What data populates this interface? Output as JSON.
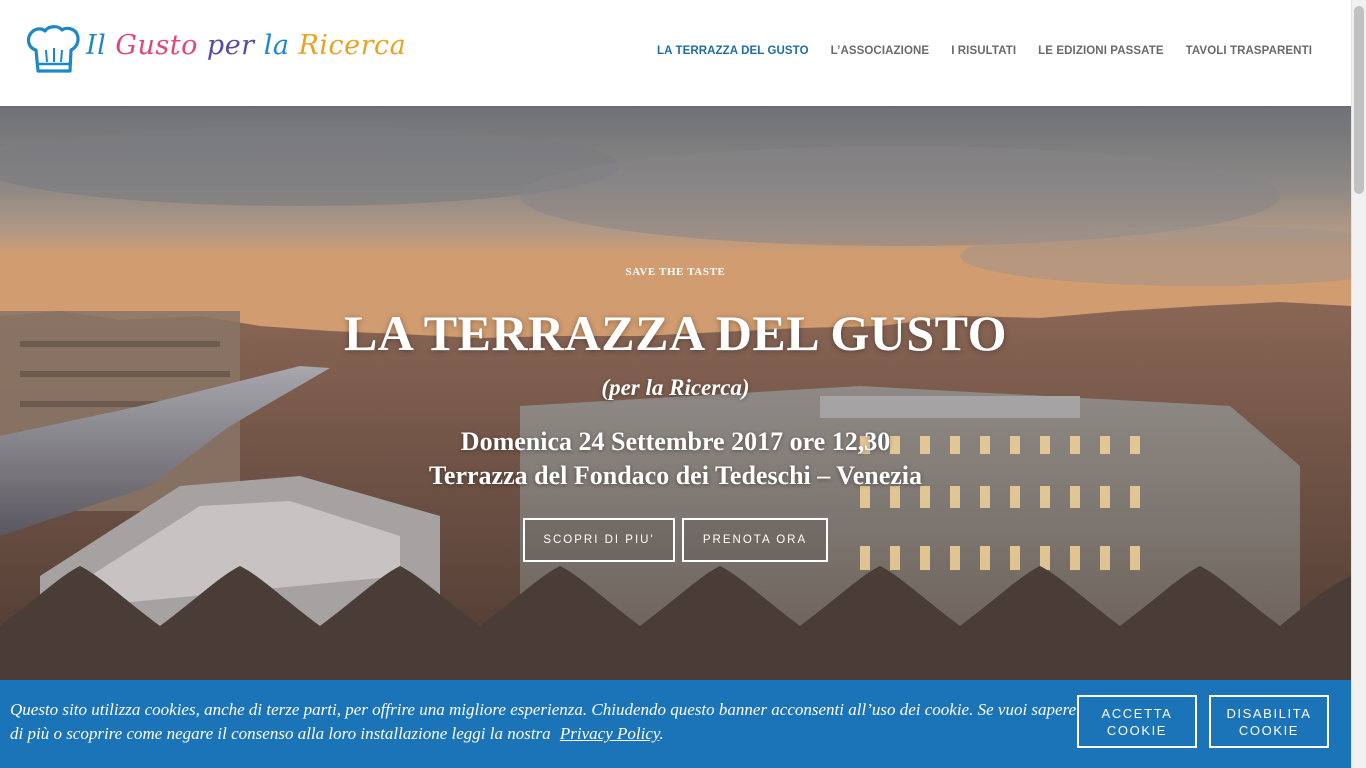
{
  "header": {
    "logo": {
      "alt": "Il Gusto per la Ricerca",
      "words": [
        "Il",
        "Gusto",
        "per",
        "la",
        "Ricerca"
      ]
    },
    "nav": [
      {
        "label": "LA TERRAZZA DEL GUSTO",
        "active": true
      },
      {
        "label": "L’ASSOCIAZIONE",
        "active": false
      },
      {
        "label": "I RISULTATI",
        "active": false
      },
      {
        "label": "LE EDIZIONI PASSATE",
        "active": false
      },
      {
        "label": "TAVOLI TRASPARENTI",
        "active": false
      }
    ]
  },
  "hero": {
    "eyebrow": "SAVE THE TASTE",
    "title": "LA TERRAZZA DEL GUSTO",
    "subtitle": "(per la Ricerca)",
    "date": "Domenica 24 Settembre 2017 ore 12,30",
    "place": "Terrazza del Fondaco dei Tedeschi – Venezia",
    "buttons": {
      "discover": "SCOPRI DI PIU'",
      "book": "PRENOTA ORA"
    }
  },
  "cookie_banner": {
    "text": "Questo sito utilizza cookies, anche di terze parti, per offrire una migliore esperienza. Chiudendo questo banner acconsenti all’uso dei cookie. Se vuoi sapere di più o scoprire come negare il consenso alla loro installazione leggi la nostra",
    "privacy_link": "Privacy Policy",
    "period": ".",
    "accept": "ACCETTA COOKIE",
    "disable": "DISABILITA COOKIE"
  },
  "colors": {
    "nav_active": "#1f6ea3",
    "nav_default": "#6a6a6a",
    "cookie_bg": "#1b74b8",
    "logo_blue": "#1d88c7",
    "logo_pink": "#e0467a",
    "logo_orange": "#e7a321"
  },
  "icons": {
    "logo_mark": "chef-hat-icon"
  }
}
